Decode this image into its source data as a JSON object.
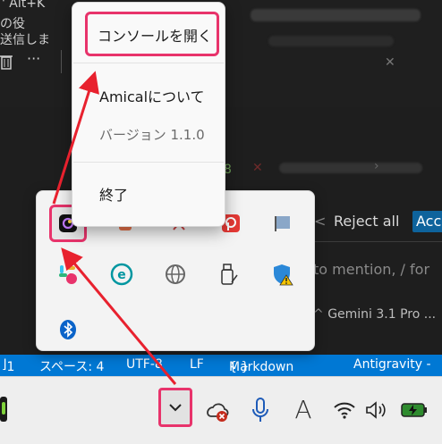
{
  "editor": {
    "title_fragment": "Alt+K",
    "title_fragment_left": "' Alt+K",
    "line_fragment": "の役",
    "line_fragment2": "送信しま",
    "toolbar_more": "···",
    "line_number": "8",
    "reject_all_label": "Reject all",
    "accept_label": "Acc",
    "chat_hint": "to mention, / for",
    "model_label": "Gemini 3.1 Pro ..."
  },
  "statusbar": {
    "line": "1",
    "spaces": "スペース: 4",
    "encoding": "UTF-8",
    "eol": "LF",
    "language": "Markdown",
    "brace": "{ }",
    "extension": "Antigravity -"
  },
  "context_menu": {
    "open_console": "コンソールを開く",
    "about": "Amicalについて",
    "version": "バージョン 1.1.0",
    "quit": "終了"
  },
  "tray_flyout": {
    "icons": [
      "amical-icon",
      "office-icon",
      "xbox-icon",
      "pdf-icon",
      "flag-icon",
      "slack-icon",
      "eset-icon",
      "globe-icon",
      "usb-drive-icon",
      "defender-warning-icon",
      "bluetooth-icon"
    ]
  },
  "taskbar": {
    "icons": [
      "app-icon",
      "chevron-up-icon",
      "onedrive-error-icon",
      "microphone-icon",
      "font-icon",
      "wifi-icon",
      "volume-icon",
      "battery-charging-icon"
    ],
    "font_glyph": "A"
  },
  "colors": {
    "highlight": "#e8336b",
    "accent_blue": "#0078d4"
  }
}
